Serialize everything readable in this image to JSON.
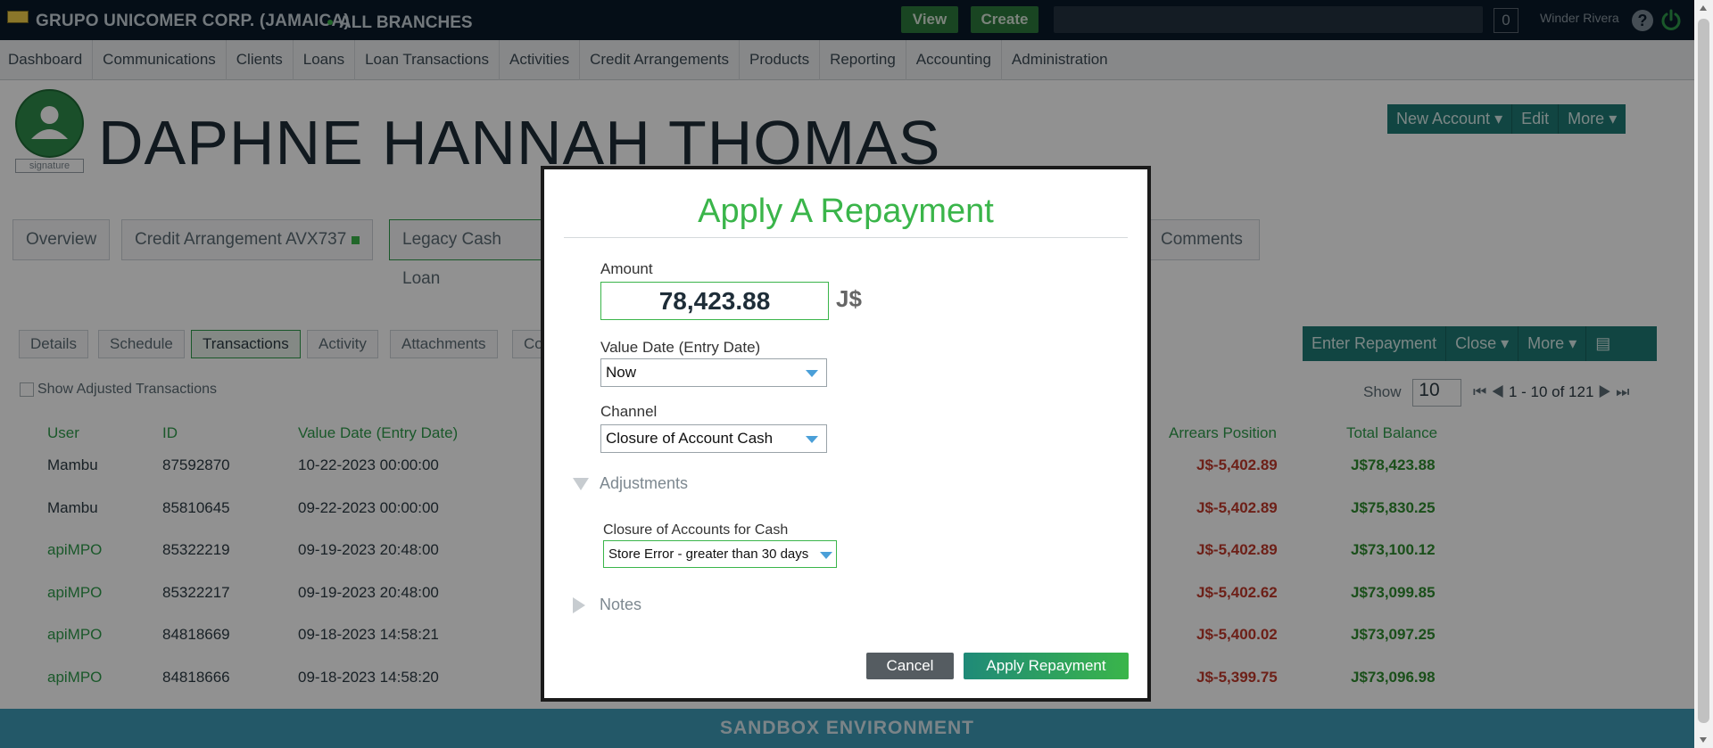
{
  "topbar": {
    "org_name": "GRUPO UNICOMER CORP. (JAMAICA)",
    "branch": "ALL BRANCHES",
    "view_label": "View",
    "create_label": "Create",
    "notification_count": "0",
    "user_name": "Winder Rivera",
    "help_glyph": "?"
  },
  "nav": {
    "items": [
      "Dashboard",
      "Communications",
      "Clients",
      "Loans",
      "Loan Transactions",
      "Activities",
      "Credit Arrangements",
      "Products",
      "Reporting",
      "Accounting",
      "Administration"
    ]
  },
  "client": {
    "name": "DAPHNE HANNAH THOMAS",
    "signature_label": "signature",
    "actions": [
      "New Account",
      "Edit",
      "More"
    ]
  },
  "tabs": [
    "Overview",
    "Credit Arrangement AVX737",
    "Legacy Cash Loan",
    "Comments"
  ],
  "subtabs": [
    "Details",
    "Schedule",
    "Transactions",
    "Activity",
    "Attachments",
    "Co"
  ],
  "loan_actions": [
    "Enter Repayment",
    "Close",
    "More"
  ],
  "show_adjusted_label": "Show Adjusted Transactions",
  "pager": {
    "show_label": "Show",
    "page_size": "10",
    "range": "1 - 10 of 121"
  },
  "table": {
    "headers": {
      "user": "User",
      "id": "ID",
      "value_date": "Value Date (Entry Date)",
      "arrears": "Arrears Position",
      "total_balance": "Total Balance"
    },
    "rows": [
      {
        "user": "Mambu",
        "id": "87592870",
        "date": "10-22-2023 00:00:00",
        "arrears": "J$-5,402.89",
        "balance": "J$78,423.88"
      },
      {
        "user": "Mambu",
        "id": "85810645",
        "date": "09-22-2023 00:00:00",
        "arrears": "J$-5,402.89",
        "balance": "J$75,830.25"
      },
      {
        "user": "apiMPO",
        "id": "85322219",
        "date": "09-19-2023 20:48:00",
        "arrears": "J$-5,402.89",
        "balance": "J$73,100.12"
      },
      {
        "user": "apiMPO",
        "id": "85322217",
        "date": "09-19-2023 20:48:00",
        "arrears": "J$-5,402.62",
        "balance": "J$73,099.85"
      },
      {
        "user": "apiMPO",
        "id": "84818669",
        "date": "09-18-2023 14:58:21",
        "arrears": "J$-5,400.02",
        "balance": "J$73,097.25"
      },
      {
        "user": "apiMPO",
        "id": "84818666",
        "date": "09-18-2023 14:58:20",
        "arrears": "J$-5,399.75",
        "balance": "J$73,096.98"
      }
    ]
  },
  "sandbox_label": "SANDBOX ENVIRONMENT",
  "modal": {
    "title": "Apply A Repayment",
    "amount_label": "Amount",
    "amount_value": "78,423.88",
    "currency": "J$",
    "value_date_label": "Value Date (Entry Date)",
    "value_date_value": "Now",
    "channel_label": "Channel",
    "channel_value": "Closure of Account Cash",
    "adjustments_label": "Adjustments",
    "closure_label": "Closure of Accounts for Cash",
    "closure_value": "Store Error - greater than 30 days",
    "notes_label": "Notes",
    "cancel_label": "Cancel",
    "apply_label": "Apply Repayment"
  },
  "colors": {
    "accent_green": "#3ab54a",
    "teal": "#1f7a74",
    "topbar": "#0a1a2a",
    "sandbox": "#3f9bb8"
  }
}
